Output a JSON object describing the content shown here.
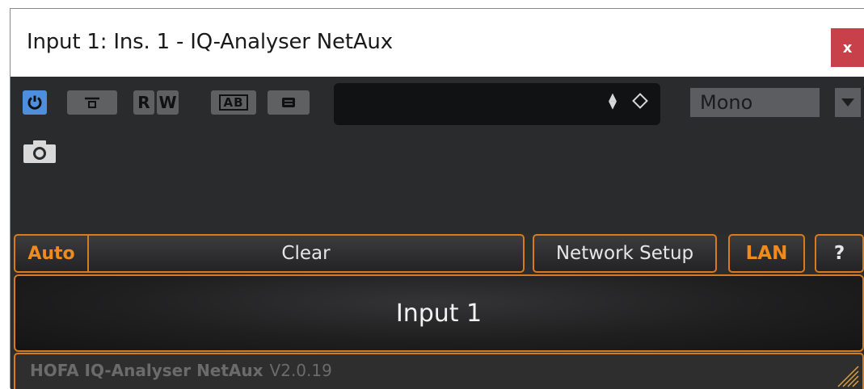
{
  "window": {
    "title": "Input 1: Ins. 1 - IQ-Analyser NetAux",
    "close_label": "x"
  },
  "toolbar": {
    "buttons": [
      {
        "icon": "power-icon",
        "active": true
      },
      {
        "icon": "bypass-icon"
      },
      {
        "icon": "read-icon",
        "label": "R"
      },
      {
        "icon": "write-icon",
        "label": "W"
      },
      {
        "icon": "ab-compare-icon",
        "label": "AB"
      },
      {
        "icon": "menu-icon"
      }
    ],
    "preset": {
      "value": "",
      "arrows_icon": "up-down-arrows-icon",
      "options_icon": "diamond-icon"
    },
    "channel": {
      "value": "Mono",
      "arrow_icon": "triangle-down-icon"
    },
    "snapshot_icon": "camera-icon"
  },
  "plugin": {
    "auto_label": "Auto",
    "clear_label": "Clear",
    "network_setup_label": "Network Setup",
    "lan_label": "LAN",
    "help_label": "?",
    "display_text": "Input 1",
    "footer_brand": "HOFA IQ-Analyser NetAux",
    "footer_version": "V2.0.19"
  },
  "colors": {
    "accent_orange": "#d97a1c",
    "power_blue": "#4d8fde",
    "close_red": "#c8404a",
    "panel_dark": "#2a2b2d"
  }
}
